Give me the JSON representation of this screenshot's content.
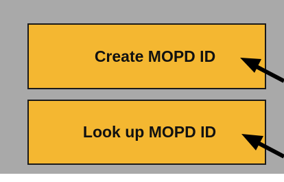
{
  "buttons": {
    "create_label": "Create MOPD ID",
    "lookup_label": "Look up MOPD ID"
  },
  "icons": {
    "create_pointer": "arrow-pointer-icon",
    "lookup_pointer": "arrow-pointer-icon"
  },
  "colors": {
    "panel_background": "#a9a9a9",
    "button_fill": "#f4b731",
    "button_border": "#1a1a1a",
    "arrow": "#000000"
  }
}
